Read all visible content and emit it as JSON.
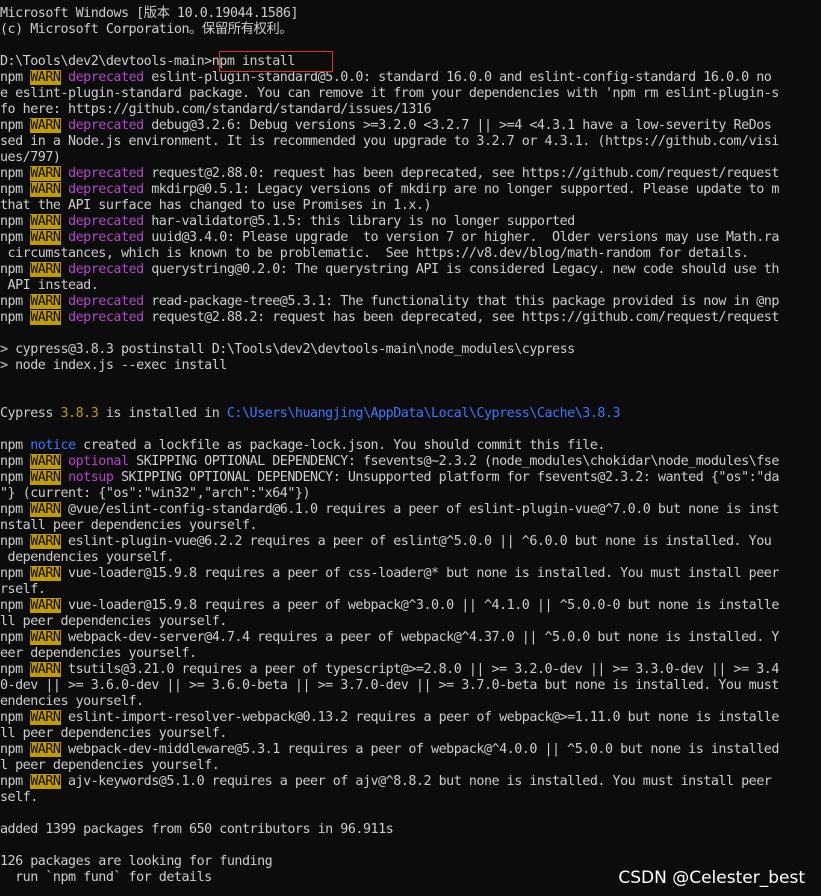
{
  "terminal": {
    "lines": [
      [
        {
          "t": "Microsoft Windows [版本 10.0.19044.1586]"
        }
      ],
      [
        {
          "t": "(c) Microsoft Corporation。保留所有权利。"
        }
      ],
      [],
      [
        {
          "t": "D:\\Tools\\dev2\\devtools-main>npm install"
        }
      ],
      [
        {
          "t": "npm "
        },
        {
          "t": "WARN",
          "c": "warn"
        },
        {
          "t": " "
        },
        {
          "t": "deprecated",
          "c": "magenta"
        },
        {
          "t": " eslint-plugin-standard@5.0.0: standard 16.0.0 and eslint-config-standard 16.0.0 no"
        }
      ],
      [
        {
          "t": "e eslint-plugin-standard package. You can remove it from your dependencies with 'npm rm eslint-plugin-s"
        }
      ],
      [
        {
          "t": "fo here: https://github.com/standard/standard/issues/1316"
        }
      ],
      [
        {
          "t": "npm "
        },
        {
          "t": "WARN",
          "c": "warn"
        },
        {
          "t": " "
        },
        {
          "t": "deprecated",
          "c": "magenta"
        },
        {
          "t": " debug@3.2.6: Debug versions >=3.2.0 <3.2.7 || >=4 <4.3.1 have a low-severity ReDos"
        }
      ],
      [
        {
          "t": "sed in a Node.js environment. It is recommended you upgrade to 3.2.7 or 4.3.1. (https://github.com/visi"
        }
      ],
      [
        {
          "t": "ues/797)"
        }
      ],
      [
        {
          "t": "npm "
        },
        {
          "t": "WARN",
          "c": "warn"
        },
        {
          "t": " "
        },
        {
          "t": "deprecated",
          "c": "magenta"
        },
        {
          "t": " request@2.88.0: request has been deprecated, see https://github.com/request/request"
        }
      ],
      [
        {
          "t": "npm "
        },
        {
          "t": "WARN",
          "c": "warn"
        },
        {
          "t": " "
        },
        {
          "t": "deprecated",
          "c": "magenta"
        },
        {
          "t": " mkdirp@0.5.1: Legacy versions of mkdirp are no longer supported. Please update to m"
        }
      ],
      [
        {
          "t": "that the API surface has changed to use Promises in 1.x.)"
        }
      ],
      [
        {
          "t": "npm "
        },
        {
          "t": "WARN",
          "c": "warn"
        },
        {
          "t": " "
        },
        {
          "t": "deprecated",
          "c": "magenta"
        },
        {
          "t": " har-validator@5.1.5: this library is no longer supported"
        }
      ],
      [
        {
          "t": "npm "
        },
        {
          "t": "WARN",
          "c": "warn"
        },
        {
          "t": " "
        },
        {
          "t": "deprecated",
          "c": "magenta"
        },
        {
          "t": " uuid@3.4.0: Please upgrade  to version 7 or higher.  Older versions may use Math.ra"
        }
      ],
      [
        {
          "t": " circumstances, which is known to be problematic.  See https://v8.dev/blog/math-random for details."
        }
      ],
      [
        {
          "t": "npm "
        },
        {
          "t": "WARN",
          "c": "warn"
        },
        {
          "t": " "
        },
        {
          "t": "deprecated",
          "c": "magenta"
        },
        {
          "t": " querystring@0.2.0: The querystring API is considered Legacy. new code should use th"
        }
      ],
      [
        {
          "t": " API instead."
        }
      ],
      [
        {
          "t": "npm "
        },
        {
          "t": "WARN",
          "c": "warn"
        },
        {
          "t": " "
        },
        {
          "t": "deprecated",
          "c": "magenta"
        },
        {
          "t": " read-package-tree@5.3.1: The functionality that this package provided is now in @np"
        }
      ],
      [
        {
          "t": "npm "
        },
        {
          "t": "WARN",
          "c": "warn"
        },
        {
          "t": " "
        },
        {
          "t": "deprecated",
          "c": "magenta"
        },
        {
          "t": " request@2.88.2: request has been deprecated, see https://github.com/request/request"
        }
      ],
      [],
      [
        {
          "t": "> cypress@3.8.3 postinstall D:\\Tools\\dev2\\devtools-main\\node_modules\\cypress"
        }
      ],
      [
        {
          "t": "> node index.js --exec install"
        }
      ],
      [],
      [],
      [
        {
          "t": "Cypress "
        },
        {
          "t": "3.8.3",
          "c": "yellow"
        },
        {
          "t": " is installed in "
        },
        {
          "t": "C:\\Users\\huangjing\\AppData\\Local\\Cypress\\Cache\\3.8.3",
          "c": "blue"
        }
      ],
      [],
      [
        {
          "t": "npm "
        },
        {
          "t": "notice",
          "c": "blue"
        },
        {
          "t": " created a lockfile as package-lock.json. You should commit this file."
        }
      ],
      [
        {
          "t": "npm "
        },
        {
          "t": "WARN",
          "c": "warn"
        },
        {
          "t": " "
        },
        {
          "t": "optional",
          "c": "magenta"
        },
        {
          "t": " SKIPPING OPTIONAL DEPENDENCY: fsevents@~2.3.2 (node_modules\\chokidar\\node_modules\\fse"
        }
      ],
      [
        {
          "t": "npm "
        },
        {
          "t": "WARN",
          "c": "warn"
        },
        {
          "t": " "
        },
        {
          "t": "notsup",
          "c": "magenta"
        },
        {
          "t": " SKIPPING OPTIONAL DEPENDENCY: Unsupported platform for fsevents@2.3.2: wanted {\"os\":\"da"
        }
      ],
      [
        {
          "t": "\"} (current: {\"os\":\"win32\",\"arch\":\"x64\"})"
        }
      ],
      [
        {
          "t": "npm "
        },
        {
          "t": "WARN",
          "c": "warn"
        },
        {
          "t": " @vue/eslint-config-standard@6.1.0 requires a peer of eslint-plugin-vue@^7.0.0 but none is inst"
        }
      ],
      [
        {
          "t": "nstall peer dependencies yourself."
        }
      ],
      [
        {
          "t": "npm "
        },
        {
          "t": "WARN",
          "c": "warn"
        },
        {
          "t": " eslint-plugin-vue@6.2.2 requires a peer of eslint@^5.0.0 || ^6.0.0 but none is installed. You"
        }
      ],
      [
        {
          "t": " dependencies yourself."
        }
      ],
      [
        {
          "t": "npm "
        },
        {
          "t": "WARN",
          "c": "warn"
        },
        {
          "t": " vue-loader@15.9.8 requires a peer of css-loader@* but none is installed. You must install peer"
        }
      ],
      [
        {
          "t": "rself."
        }
      ],
      [
        {
          "t": "npm "
        },
        {
          "t": "WARN",
          "c": "warn"
        },
        {
          "t": " vue-loader@15.9.8 requires a peer of webpack@^3.0.0 || ^4.1.0 || ^5.0.0-0 but none is installe"
        }
      ],
      [
        {
          "t": "ll peer dependencies yourself."
        }
      ],
      [
        {
          "t": "npm "
        },
        {
          "t": "WARN",
          "c": "warn"
        },
        {
          "t": " webpack-dev-server@4.7.4 requires a peer of webpack@^4.37.0 || ^5.0.0 but none is installed. Y"
        }
      ],
      [
        {
          "t": "eer dependencies yourself."
        }
      ],
      [
        {
          "t": "npm "
        },
        {
          "t": "WARN",
          "c": "warn"
        },
        {
          "t": " tsutils@3.21.0 requires a peer of typescript@>=2.8.0 || >= 3.2.0-dev || >= 3.3.0-dev || >= 3.4"
        }
      ],
      [
        {
          "t": "0-dev || >= 3.6.0-dev || >= 3.6.0-beta || >= 3.7.0-dev || >= 3.7.0-beta but none is installed. You must"
        }
      ],
      [
        {
          "t": "endencies yourself."
        }
      ],
      [
        {
          "t": "npm "
        },
        {
          "t": "WARN",
          "c": "warn"
        },
        {
          "t": " eslint-import-resolver-webpack@0.13.2 requires a peer of webpack@>=1.11.0 but none is installe"
        }
      ],
      [
        {
          "t": "ll peer dependencies yourself."
        }
      ],
      [
        {
          "t": "npm "
        },
        {
          "t": "WARN",
          "c": "warn"
        },
        {
          "t": " webpack-dev-middleware@5.3.1 requires a peer of webpack@^4.0.0 || ^5.0.0 but none is installed"
        }
      ],
      [
        {
          "t": "l peer dependencies yourself."
        }
      ],
      [
        {
          "t": "npm "
        },
        {
          "t": "WARN",
          "c": "warn"
        },
        {
          "t": " ajv-keywords@5.1.0 requires a peer of ajv@^8.8.2 but none is installed. You must install peer"
        }
      ],
      [
        {
          "t": "self."
        }
      ],
      [],
      [
        {
          "t": "added 1399 packages from 650 contributors in 96.911s"
        }
      ],
      [],
      [
        {
          "t": "126 packages are looking for funding"
        }
      ],
      [
        {
          "t": "  run `npm fund` for details"
        }
      ]
    ]
  },
  "watermark": "CSDN @Celester_best",
  "colors": {
    "background": "#0c0c0c",
    "foreground": "#cccccc",
    "warn_badge": "#c19c00",
    "deprecated": "#b148c6",
    "link": "#3b78ff",
    "highlight_box": "#e0302f"
  }
}
